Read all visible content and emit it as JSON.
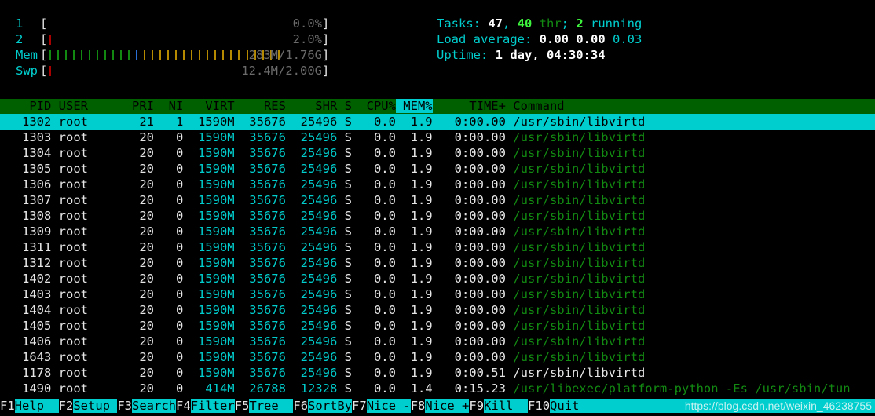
{
  "app": {
    "name": "htop"
  },
  "colors": {
    "background": "#000000",
    "cyan": "#00cdcd",
    "header_green": "#006000",
    "command_green": "#128a12",
    "bar_green": "#128a12",
    "bar_blue": "#2a6fd6",
    "bar_orange": "#b58900",
    "bar_red": "#aa0000",
    "meter_value_gray": "#6b6b6b",
    "selected_bg": "#00cdcd"
  },
  "meters": [
    {
      "label": "1  ",
      "value": "0.0%",
      "bars": []
    },
    {
      "label": "2  ",
      "value": "2.0%",
      "bars": [
        {
          "color": "#aa0000",
          "count": 1
        }
      ]
    },
    {
      "label": "Mem",
      "value": "283M/1.76G",
      "bars": [
        {
          "color": "#128a12",
          "count": 11
        },
        {
          "color": "#2a6fd6",
          "count": 1
        },
        {
          "color": "#b58900",
          "count": 18
        }
      ]
    },
    {
      "label": "Swp",
      "value": "12.4M/2.00G",
      "bars": [
        {
          "color": "#aa0000",
          "count": 1
        }
      ]
    }
  ],
  "info": {
    "tasks": {
      "label": "Tasks: ",
      "total": "47",
      "sep1": ", ",
      "threads": "40",
      "thr_word": " thr",
      "sep2": "; ",
      "running": "2",
      "running_word": " running"
    },
    "load": {
      "label": "Load average: ",
      "one": "0.00",
      "five": "0.00",
      "fifteen": "0.03"
    },
    "uptime": {
      "label": "Uptime: ",
      "value": "1 day, 04:30:34"
    }
  },
  "table": {
    "columns": [
      {
        "key": "pid",
        "label": "PID",
        "width": 7,
        "align": "right",
        "highlight": false
      },
      {
        "key": "user",
        "label": "USER",
        "width": 10,
        "align": "left",
        "highlight": false
      },
      {
        "key": "pri",
        "label": "PRI",
        "width": 4,
        "align": "right",
        "highlight": false
      },
      {
        "key": "ni",
        "label": "NI",
        "width": 4,
        "align": "right",
        "highlight": false
      },
      {
        "key": "virt",
        "label": "VIRT",
        "width": 7,
        "align": "right",
        "highlight": false
      },
      {
        "key": "res",
        "label": "RES",
        "width": 7,
        "align": "right",
        "highlight": false
      },
      {
        "key": "shr",
        "label": "SHR",
        "width": 7,
        "align": "right",
        "highlight": false
      },
      {
        "key": "s",
        "label": "S",
        "width": 2,
        "align": "right",
        "highlight": false
      },
      {
        "key": "cpu",
        "label": "CPU%",
        "width": 6,
        "align": "right",
        "highlight": false
      },
      {
        "key": "mem",
        "label": "MEM%",
        "width": 5,
        "align": "right",
        "highlight": true
      },
      {
        "key": "time",
        "label": "TIME+",
        "width": 10,
        "align": "right",
        "highlight": false
      },
      {
        "key": "command",
        "label": "Command",
        "width": 0,
        "align": "left",
        "highlight": false
      }
    ],
    "header_raw": "  PID USER      PRI  NI  VIRT   RES   SHR S CPU% MEM%   TIME+  Command",
    "rows": [
      {
        "pid": "1302",
        "user": "root",
        "pri": "21",
        "ni": "1",
        "virt": "1590M",
        "res": "35676",
        "shr": "25496",
        "s": "S",
        "cpu": "0.0",
        "mem": "1.9",
        "time": "0:00.00",
        "command": "/usr/sbin/libvirtd",
        "selected": true,
        "thread": false
      },
      {
        "pid": "1303",
        "user": "root",
        "pri": "20",
        "ni": "0",
        "virt": "1590M",
        "res": "35676",
        "shr": "25496",
        "s": "S",
        "cpu": "0.0",
        "mem": "1.9",
        "time": "0:00.00",
        "command": "/usr/sbin/libvirtd",
        "selected": false,
        "thread": true
      },
      {
        "pid": "1304",
        "user": "root",
        "pri": "20",
        "ni": "0",
        "virt": "1590M",
        "res": "35676",
        "shr": "25496",
        "s": "S",
        "cpu": "0.0",
        "mem": "1.9",
        "time": "0:00.00",
        "command": "/usr/sbin/libvirtd",
        "selected": false,
        "thread": true
      },
      {
        "pid": "1305",
        "user": "root",
        "pri": "20",
        "ni": "0",
        "virt": "1590M",
        "res": "35676",
        "shr": "25496",
        "s": "S",
        "cpu": "0.0",
        "mem": "1.9",
        "time": "0:00.00",
        "command": "/usr/sbin/libvirtd",
        "selected": false,
        "thread": true
      },
      {
        "pid": "1306",
        "user": "root",
        "pri": "20",
        "ni": "0",
        "virt": "1590M",
        "res": "35676",
        "shr": "25496",
        "s": "S",
        "cpu": "0.0",
        "mem": "1.9",
        "time": "0:00.00",
        "command": "/usr/sbin/libvirtd",
        "selected": false,
        "thread": true
      },
      {
        "pid": "1307",
        "user": "root",
        "pri": "20",
        "ni": "0",
        "virt": "1590M",
        "res": "35676",
        "shr": "25496",
        "s": "S",
        "cpu": "0.0",
        "mem": "1.9",
        "time": "0:00.00",
        "command": "/usr/sbin/libvirtd",
        "selected": false,
        "thread": true
      },
      {
        "pid": "1308",
        "user": "root",
        "pri": "20",
        "ni": "0",
        "virt": "1590M",
        "res": "35676",
        "shr": "25496",
        "s": "S",
        "cpu": "0.0",
        "mem": "1.9",
        "time": "0:00.00",
        "command": "/usr/sbin/libvirtd",
        "selected": false,
        "thread": true
      },
      {
        "pid": "1309",
        "user": "root",
        "pri": "20",
        "ni": "0",
        "virt": "1590M",
        "res": "35676",
        "shr": "25496",
        "s": "S",
        "cpu": "0.0",
        "mem": "1.9",
        "time": "0:00.00",
        "command": "/usr/sbin/libvirtd",
        "selected": false,
        "thread": true
      },
      {
        "pid": "1311",
        "user": "root",
        "pri": "20",
        "ni": "0",
        "virt": "1590M",
        "res": "35676",
        "shr": "25496",
        "s": "S",
        "cpu": "0.0",
        "mem": "1.9",
        "time": "0:00.00",
        "command": "/usr/sbin/libvirtd",
        "selected": false,
        "thread": true
      },
      {
        "pid": "1312",
        "user": "root",
        "pri": "20",
        "ni": "0",
        "virt": "1590M",
        "res": "35676",
        "shr": "25496",
        "s": "S",
        "cpu": "0.0",
        "mem": "1.9",
        "time": "0:00.00",
        "command": "/usr/sbin/libvirtd",
        "selected": false,
        "thread": true
      },
      {
        "pid": "1402",
        "user": "root",
        "pri": "20",
        "ni": "0",
        "virt": "1590M",
        "res": "35676",
        "shr": "25496",
        "s": "S",
        "cpu": "0.0",
        "mem": "1.9",
        "time": "0:00.00",
        "command": "/usr/sbin/libvirtd",
        "selected": false,
        "thread": true
      },
      {
        "pid": "1403",
        "user": "root",
        "pri": "20",
        "ni": "0",
        "virt": "1590M",
        "res": "35676",
        "shr": "25496",
        "s": "S",
        "cpu": "0.0",
        "mem": "1.9",
        "time": "0:00.00",
        "command": "/usr/sbin/libvirtd",
        "selected": false,
        "thread": true
      },
      {
        "pid": "1404",
        "user": "root",
        "pri": "20",
        "ni": "0",
        "virt": "1590M",
        "res": "35676",
        "shr": "25496",
        "s": "S",
        "cpu": "0.0",
        "mem": "1.9",
        "time": "0:00.00",
        "command": "/usr/sbin/libvirtd",
        "selected": false,
        "thread": true
      },
      {
        "pid": "1405",
        "user": "root",
        "pri": "20",
        "ni": "0",
        "virt": "1590M",
        "res": "35676",
        "shr": "25496",
        "s": "S",
        "cpu": "0.0",
        "mem": "1.9",
        "time": "0:00.00",
        "command": "/usr/sbin/libvirtd",
        "selected": false,
        "thread": true
      },
      {
        "pid": "1406",
        "user": "root",
        "pri": "20",
        "ni": "0",
        "virt": "1590M",
        "res": "35676",
        "shr": "25496",
        "s": "S",
        "cpu": "0.0",
        "mem": "1.9",
        "time": "0:00.00",
        "command": "/usr/sbin/libvirtd",
        "selected": false,
        "thread": true
      },
      {
        "pid": "1643",
        "user": "root",
        "pri": "20",
        "ni": "0",
        "virt": "1590M",
        "res": "35676",
        "shr": "25496",
        "s": "S",
        "cpu": "0.0",
        "mem": "1.9",
        "time": "0:00.00",
        "command": "/usr/sbin/libvirtd",
        "selected": false,
        "thread": true
      },
      {
        "pid": "1178",
        "user": "root",
        "pri": "20",
        "ni": "0",
        "virt": "1590M",
        "res": "35676",
        "shr": "25496",
        "s": "S",
        "cpu": "0.0",
        "mem": "1.9",
        "time": "0:00.51",
        "command": "/usr/sbin/libvirtd",
        "selected": false,
        "thread": false
      },
      {
        "pid": "1490",
        "user": "root",
        "pri": "20",
        "ni": "0",
        "virt": "414M",
        "res": "26788",
        "shr": "12328",
        "s": "S",
        "cpu": "0.0",
        "mem": "1.4",
        "time": "0:15.23",
        "command": "/usr/libexec/platform-python -Es /usr/sbin/tun",
        "selected": false,
        "thread": true
      }
    ]
  },
  "function_bar": {
    "keys": [
      {
        "key": "F1",
        "label": "Help  "
      },
      {
        "key": "F2",
        "label": "Setup "
      },
      {
        "key": "F3",
        "label": "Search"
      },
      {
        "key": "F4",
        "label": "Filter"
      },
      {
        "key": "F5",
        "label": "Tree  "
      },
      {
        "key": "F6",
        "label": "SortBy"
      },
      {
        "key": "F7",
        "label": "Nice -"
      },
      {
        "key": "F8",
        "label": "Nice +"
      },
      {
        "key": "F9",
        "label": "Kill  "
      },
      {
        "key": "F10",
        "label": "Quit  "
      }
    ]
  },
  "watermark": {
    "text": "https://blog.csdn.net/weixin_46238755"
  }
}
